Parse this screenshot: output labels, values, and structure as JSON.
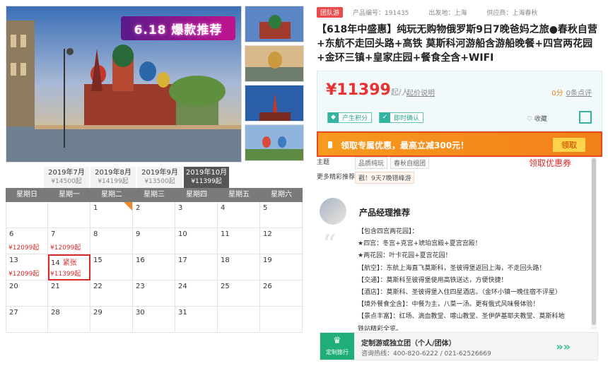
{
  "gallery": {
    "promo_title": "6.18 爆款推荐"
  },
  "months": [
    {
      "label": "2019年7月",
      "price": "¥14500起"
    },
    {
      "label": "2019年8月",
      "price": "¥14199起"
    },
    {
      "label": "2019年9月",
      "price": "¥13500起"
    },
    {
      "label": "2019年10月",
      "price": "¥11399起"
    }
  ],
  "weekdays": [
    "星期日",
    "星期一",
    "星期二",
    "星期三",
    "星期四",
    "星期五",
    "星期六"
  ],
  "calendar": {
    "rows": [
      [
        {
          "day": ""
        },
        {
          "day": ""
        },
        {
          "day": "1"
        },
        {
          "day": "2"
        },
        {
          "day": "3"
        },
        {
          "day": "4"
        },
        {
          "day": "5"
        }
      ],
      [
        {
          "day": "6",
          "price": "¥12099起"
        },
        {
          "day": "7",
          "price": "¥12099起"
        },
        {
          "day": "8"
        },
        {
          "day": "9"
        },
        {
          "day": "10"
        },
        {
          "day": "11"
        },
        {
          "day": "12"
        }
      ],
      [
        {
          "day": "13",
          "price": "¥12099起"
        },
        {
          "day": "14",
          "tag": "紧张",
          "price": "¥11399起"
        },
        {
          "day": "15"
        },
        {
          "day": "16"
        },
        {
          "day": "17"
        },
        {
          "day": "18"
        },
        {
          "day": "19"
        }
      ],
      [
        {
          "day": "20"
        },
        {
          "day": "21"
        },
        {
          "day": "22"
        },
        {
          "day": "23"
        },
        {
          "day": "24"
        },
        {
          "day": "25"
        },
        {
          "day": "26"
        }
      ],
      [
        {
          "day": "27"
        },
        {
          "day": "28"
        },
        {
          "day": "29"
        },
        {
          "day": "30"
        },
        {
          "day": "31"
        },
        {
          "day": ""
        },
        {
          "day": ""
        }
      ]
    ]
  },
  "product": {
    "badge": "团队游",
    "code": "产品编号：191435",
    "departure": "出发地：上海",
    "supplier": "供应商：上海春秋",
    "title": "【618年中盛惠】纯玩无购物俄罗斯9日7晚爸妈之旅●春秋自营+东航不走回头路+高铁 莫斯科河游船含游船晚餐+四宫两花园+金环三镇+皇家庄园+餐食全含+WIFI",
    "price": "¥11399",
    "price_unit": "起/人",
    "price_rule": "起价说明",
    "score": "0分",
    "reviews": "0条点评",
    "chip1": "产生积分",
    "chip2": "即时确认",
    "favorite": "♡ 收藏"
  },
  "coupon": {
    "text": "领取专属优惠，最高立减300元！",
    "button": "领取",
    "annotation": "领取优惠券"
  },
  "topics": {
    "label1": "主题",
    "tags": [
      "品质纯玩",
      "春秋自组团"
    ],
    "label2": "更多精彩推荐",
    "rec": "戳！9天7晚错峰游"
  },
  "manager": {
    "title": "产品经理推荐",
    "lines": [
      "【包含四宫两花园】：",
      "★四宫：冬宫+克宫+琥珀宫殿+夏宫宫殿！",
      "★两花园：叶卡花园+夏宫花园！",
      "【航空】：东航上海直飞莫斯科，圣彼得堡返回上海，不走回头路！",
      "【交通】：莫斯科至彼得堡使用高铁送达，方便快捷！",
      "【酒店】：莫斯科、圣彼得堡入住四星酒店。（金环小镇一晚住宿不评星）",
      "【境外餐食全含】：中餐为主，八菜一汤。更有俄式风味餐体验！",
      "【景点丰富】：红场、滴血教堂、喀山教堂、圣伊萨基耶夫教堂、莫斯科地",
      "铁站精彩全览。"
    ]
  },
  "footer": {
    "icon_label": "定制旅行",
    "title": "定制游或独立团（个人/团体）",
    "hotline": "咨询热线：400-820-6222 / 021-62526669"
  }
}
